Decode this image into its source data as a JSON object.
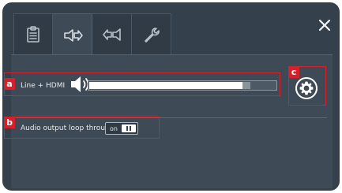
{
  "tabs": [
    {
      "icon": "clipboard-icon"
    },
    {
      "icon": "speaker-output-icon",
      "active": true
    },
    {
      "icon": "audio-input-icon"
    },
    {
      "icon": "wrench-icon"
    }
  ],
  "close_icon": "close-icon",
  "volume": {
    "label": "Line + HDMI",
    "icon": "speaker-volume-icon",
    "level": 0.82
  },
  "loop_through": {
    "label": "Audio output loop through",
    "state_label": "on",
    "enabled": true
  },
  "settings_icon": "gear-icon",
  "callouts": [
    {
      "letter": "a"
    },
    {
      "letter": "b"
    },
    {
      "letter": "c"
    }
  ],
  "colors": {
    "panel_bg": "#34414d",
    "content_bg": "#3e4b57",
    "callout_red": "#d4212b",
    "text": "#e6eaed"
  }
}
